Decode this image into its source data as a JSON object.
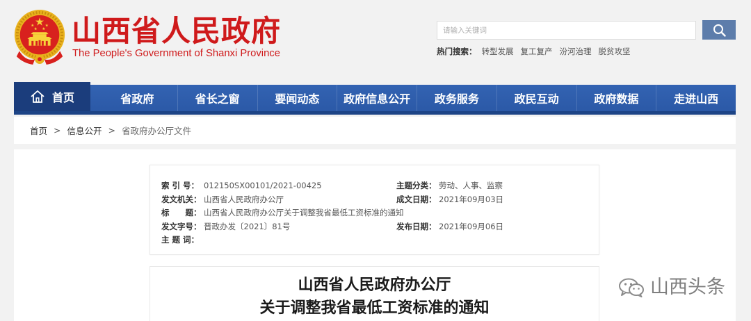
{
  "header": {
    "title": "山西省人民政府",
    "subtitle": "The People's Government of Shanxi Province",
    "logo_icon": "national-emblem-logo",
    "search": {
      "placeholder": "请输入关键词",
      "button_icon": "search-icon"
    },
    "hot_search": {
      "label": "热门搜索：",
      "items": [
        "转型发展",
        "复工复产",
        "汾河治理",
        "脱贫攻坚"
      ]
    }
  },
  "nav": {
    "items": [
      {
        "label": "首页",
        "icon": "home-icon",
        "active": true
      },
      {
        "label": "省政府",
        "active": false
      },
      {
        "label": "省长之窗",
        "active": false
      },
      {
        "label": "要闻动态",
        "active": false
      },
      {
        "label": "政府信息公开",
        "active": false
      },
      {
        "label": "政务服务",
        "active": false
      },
      {
        "label": "政民互动",
        "active": false
      },
      {
        "label": "政府数据",
        "active": false
      },
      {
        "label": "走进山西",
        "active": false
      }
    ]
  },
  "breadcrumb": {
    "separator": ">",
    "items": [
      "首页",
      "信息公开",
      "省政府办公厅文件"
    ]
  },
  "document_meta": {
    "index": {
      "label": "索 引 号：",
      "value": "012150SX00101/2021-00425"
    },
    "category": {
      "label": "主题分类：",
      "value": "劳动、人事、监察"
    },
    "issuer": {
      "label": "发文机关：",
      "value": "山西省人民政府办公厅"
    },
    "written_date": {
      "label": "成文日期：",
      "value": "2021年09月03日"
    },
    "title": {
      "label": "标　　题：",
      "value": "山西省人民政府办公厅关于调整我省最低工资标准的通知"
    },
    "doc_number": {
      "label": "发文字号：",
      "value": "晋政办发〔2021〕81号"
    },
    "publish_date": {
      "label": "发布日期：",
      "value": "2021年09月06日"
    },
    "keywords": {
      "label": "主 题 词：",
      "value": ""
    }
  },
  "document": {
    "title_line1": "山西省人民政府办公厅",
    "title_line2": "关于调整我省最低工资标准的通知"
  },
  "watermark": {
    "icon": "wechat-icon",
    "text": "山西头条"
  },
  "colors": {
    "brand_red": "#cf1a1b",
    "nav_blue": "#2f5ead",
    "nav_active": "#1b3d7c",
    "nav_bottom": "#1d4486",
    "search_button": "#5d7dab",
    "page_background": "#f2f2f2"
  }
}
